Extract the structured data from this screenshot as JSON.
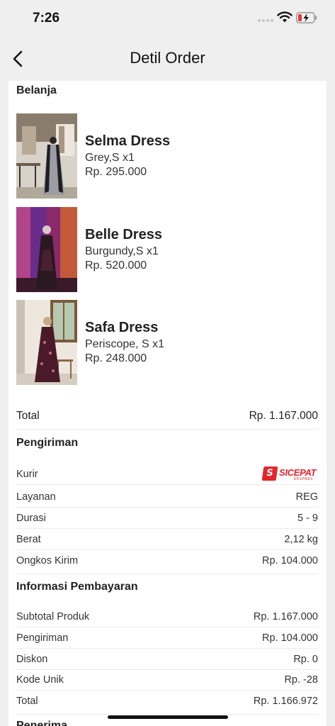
{
  "status_bar": {
    "time": "7:26"
  },
  "header": {
    "title": "Detil Order"
  },
  "belanja": {
    "title": "Belanja",
    "items": [
      {
        "name": "Selma Dress",
        "variant": "Grey,S x1",
        "price": "Rp. 295.000"
      },
      {
        "name": "Belle Dress",
        "variant": "Burgundy,S x1",
        "price": "Rp. 520.000"
      },
      {
        "name": "Safa Dress",
        "variant": "Periscope, S x1",
        "price": "Rp. 248.000"
      }
    ],
    "total_label": "Total",
    "total_value": "Rp. 1.167.000"
  },
  "pengiriman": {
    "title": "Pengiriman",
    "kurir_label": "Kurir",
    "kurir_logo_text": "SICEPAT",
    "kurir_logo_sub": "EKSPRES",
    "rows": [
      {
        "label": "Layanan",
        "value": "REG"
      },
      {
        "label": "Durasi",
        "value": "5 - 9"
      },
      {
        "label": "Berat",
        "value": "2,12 kg"
      },
      {
        "label": "Ongkos Kirim",
        "value": "Rp. 104.000"
      }
    ]
  },
  "pembayaran": {
    "title": "Informasi Pembayaran",
    "rows": [
      {
        "label": "Subtotal Produk",
        "value": "Rp. 1.167.000"
      },
      {
        "label": "Pengiriman",
        "value": "Rp. 104.000"
      },
      {
        "label": "Diskon",
        "value": "Rp. 0"
      },
      {
        "label": "Kode Unik",
        "value": "Rp. -28"
      },
      {
        "label": "Total",
        "value": "Rp. 1.166.972"
      }
    ]
  },
  "penerima": {
    "title": "Penerima"
  },
  "colors": {
    "background": "#efefef",
    "card": "#ffffff",
    "courier_brand": "#e3262e",
    "battery_low": "#e0393e"
  }
}
